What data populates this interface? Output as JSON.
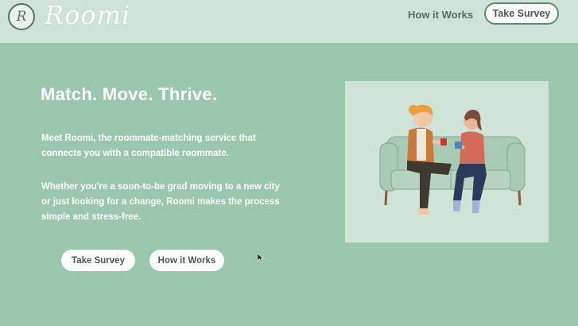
{
  "header": {
    "logo_letter": "R",
    "brand": "Roomi",
    "nav_how_it_works": "How it Works",
    "nav_take_survey": "Take Survey"
  },
  "hero": {
    "headline": "Match. Move. Thrive.",
    "paragraph1": "Meet Roomi, the roommate-matching service that connects you with a compatible roommate.",
    "paragraph2": "Whether you're a soon-to-be grad moving to a new city or just looking for a change, Roomi makes the process simple and stress-free.",
    "cta_survey": "Take Survey",
    "cta_how": "How it Works"
  },
  "colors": {
    "page_bg": "#9bc7af",
    "header_bg": "#cfe3d9",
    "button_bg": "#ffffff",
    "text_white": "#ffffff"
  },
  "icons": {
    "logo": "r-logo-icon",
    "cursor": "mouse-pointer-icon"
  }
}
